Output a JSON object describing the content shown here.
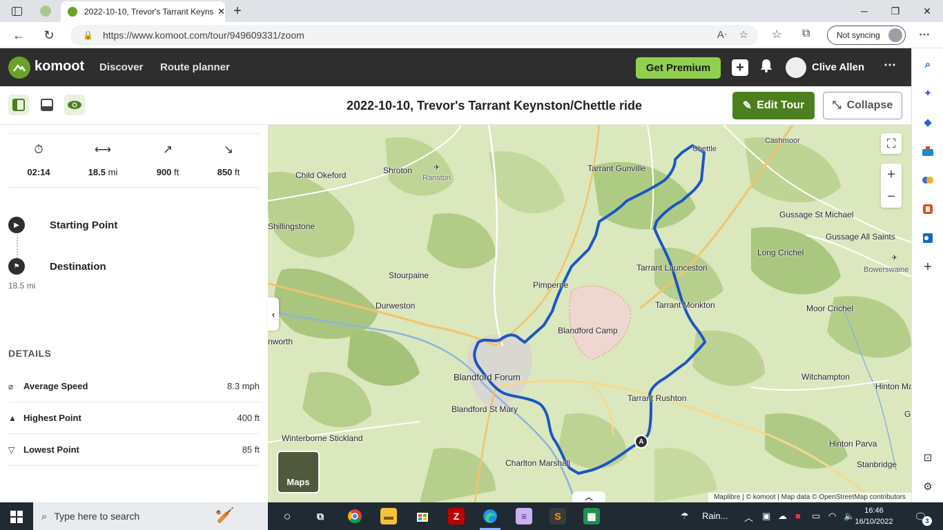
{
  "browser": {
    "active_tab_title": "2022-10-10, Trevor's Tarrant Keynston/Chettle ride",
    "url": "https://www.komoot.com/tour/949609331/zoom",
    "sync_label": "Not syncing",
    "window_buttons": [
      "─",
      "❐",
      "✕"
    ]
  },
  "komoot": {
    "logo_text": "komoot",
    "nav": [
      "Discover",
      "Route planner"
    ],
    "premium_label": "Get Premium",
    "user_name": "Clive Allen",
    "brand_color": "#6aa127"
  },
  "tour": {
    "title": "2022-10-10, Trevor's Tarrant Keynston/Chettle ride",
    "edit_label": "Edit Tour",
    "collapse_label": "Collapse"
  },
  "stats": [
    {
      "icon": "stopwatch-icon",
      "value": "02:14",
      "unit": ""
    },
    {
      "icon": "distance-icon",
      "value": "18.5",
      "unit": "mi"
    },
    {
      "icon": "uphill-icon",
      "value": "900",
      "unit": "ft"
    },
    {
      "icon": "downhill-icon",
      "value": "850",
      "unit": "ft"
    }
  ],
  "waypoints": {
    "start": "Starting Point",
    "end": "Destination",
    "end_distance": "18.5 mi"
  },
  "details": {
    "heading": "DETAILS",
    "rows": [
      {
        "label": "Average Speed",
        "value": "8.3 mph"
      },
      {
        "label": "Highest Point",
        "value": "400 ft"
      },
      {
        "label": "Lowest Point",
        "value": "85 ft"
      }
    ]
  },
  "map": {
    "places": {
      "chettle": "Chettle",
      "cashmoor": "Cashmoor",
      "shroton": "Shroton",
      "ranston": "Ranston",
      "child_okeford": "Child Okeford",
      "tarrant_gunville": "Tarrant Gunville",
      "gussage_st_michael": "Gussage St Michael",
      "gussage_all_saints": "Gussage All Saints",
      "shillingstone": "Shillingstone",
      "long_crichel": "Long Crichel",
      "bowerswaine": "Bowerswaine",
      "tarrant_launceston": "Tarrant Launceston",
      "stourpaine": "Stourpaine",
      "pimperne": "Pimperne",
      "tarrant_monkton": "Tarrant Monkton",
      "moor_crichel": "Moor Crichel",
      "durweston": "Durweston",
      "blandford_camp": "Blandford Camp",
      "winterborne_whitechurch": "nworth",
      "blandford_forum": "Blandford Forum",
      "witchampton": "Witchampton",
      "hinton_martell": "Hinton Ma",
      "tarrant_rushton": "Tarrant Rushton",
      "blandford_st_mary": "Blandford St Mary",
      "gaunts": "G",
      "winterborne_stickland": "Winterborne Stickland",
      "hinton_parva": "Hinton Parva",
      "charlton_marshall": "Charlton Marshall",
      "stanbridge": "Stanbridge"
    },
    "marker_label": "A",
    "layer_button": "Maps",
    "attribution": "Maplibre | © komoot | Map data © OpenStreetMap contributors",
    "route_color": "#1a56c4"
  },
  "taskbar": {
    "search_placeholder": "Type here to search",
    "weather": "Rain...",
    "time": "16:46",
    "date": "16/10/2022",
    "notification_count": "3"
  }
}
